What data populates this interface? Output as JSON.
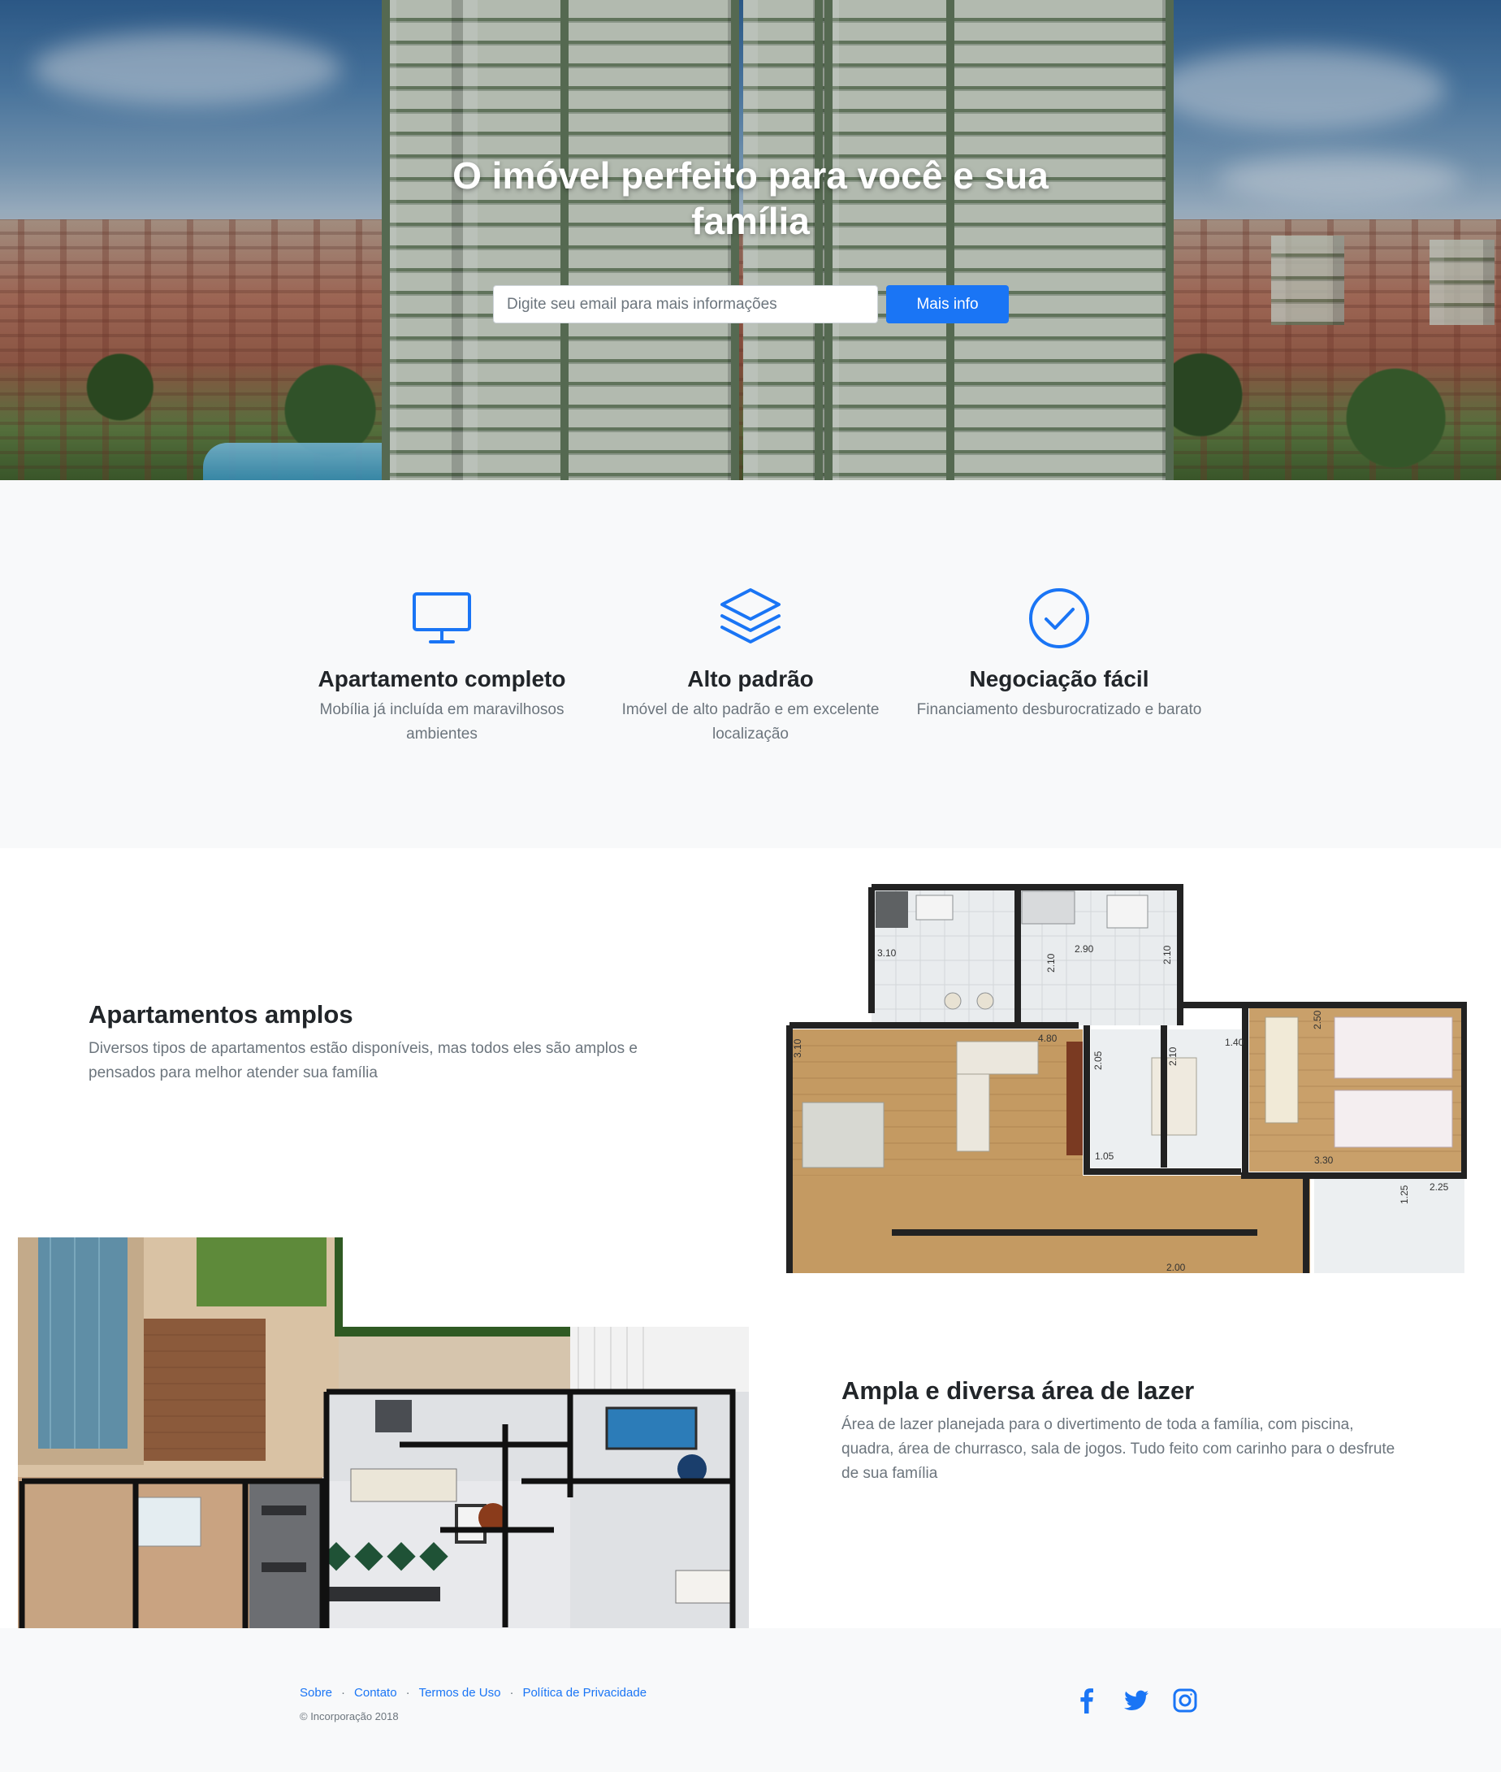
{
  "hero": {
    "title": "O imóvel perfeito para você e sua família",
    "email_placeholder": "Digite seu email para mais informações",
    "email_value": "",
    "button_label": "Mais info"
  },
  "features": [
    {
      "icon": "monitor-icon",
      "title": "Apartamento completo",
      "text": "Mobília já incluída em maravilhosos ambientes"
    },
    {
      "icon": "layers-icon",
      "title": "Alto padrão",
      "text": "Imóvel de alto padrão e em excelente localização"
    },
    {
      "icon": "check-circle-icon",
      "title": "Negociação fácil",
      "text": "Financiamento desburocratizado e barato"
    }
  ],
  "showcase": [
    {
      "title": "Apartamentos amplos",
      "text": "Diversos tipos de apartamentos estão disponíveis, mas todos eles são amplos e pensados para melhor atender sua família"
    },
    {
      "title": "Ampla e diversa área de lazer",
      "text": "Área de lazer planejada para o divertimento de toda a família, com piscina, quadra, área de churrasco, sala de jogos. Tudo feito com carinho para o desfrute de sua família"
    }
  ],
  "plan_labels": [
    "3.10",
    "2.10",
    "2.90",
    "2.10",
    "4.80",
    "2.05",
    "2.10",
    "1.40",
    "2.50",
    "3.10",
    "1.05",
    "3.30",
    "1.25",
    "2.25",
    "2.00"
  ],
  "footer": {
    "links": [
      "Sobre",
      "Contato",
      "Termos de Uso",
      "Política de Privacidade"
    ],
    "separator": "·",
    "copyright": "© Incorporação 2018",
    "social": [
      "facebook-icon",
      "twitter-icon",
      "instagram-icon"
    ]
  },
  "colors": {
    "accent": "#1a75f5",
    "muted_text": "#6c757d",
    "heading": "#212529",
    "section_bg": "#f8f9fa"
  }
}
